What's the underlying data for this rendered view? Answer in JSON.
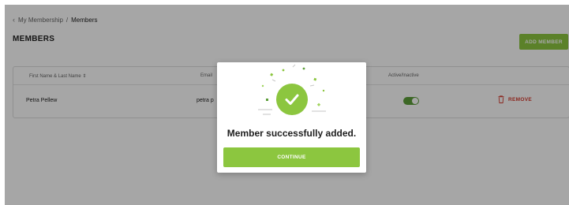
{
  "breadcrumb": {
    "parent": "My Membership",
    "separator": "/",
    "current": "Members"
  },
  "page_title": "MEMBERS",
  "add_button": "ADD MEMBER",
  "table": {
    "headers": {
      "name": "First Name & Last Name ⇕",
      "email": "Email",
      "status": "Active/Inactive"
    },
    "rows": [
      {
        "name": "Petra Pellew",
        "email": "petra p",
        "active": true,
        "remove_label": "REMOVE"
      }
    ]
  },
  "modal": {
    "message": "Member successfully added.",
    "button": "CONTINUE"
  },
  "icons": {
    "back": "chevron-left-icon",
    "check": "checkmark-icon",
    "trash": "trash-icon"
  },
  "colors": {
    "accent": "#8cc63f",
    "toggle": "#5d9e3a",
    "danger": "#d63b2f"
  }
}
